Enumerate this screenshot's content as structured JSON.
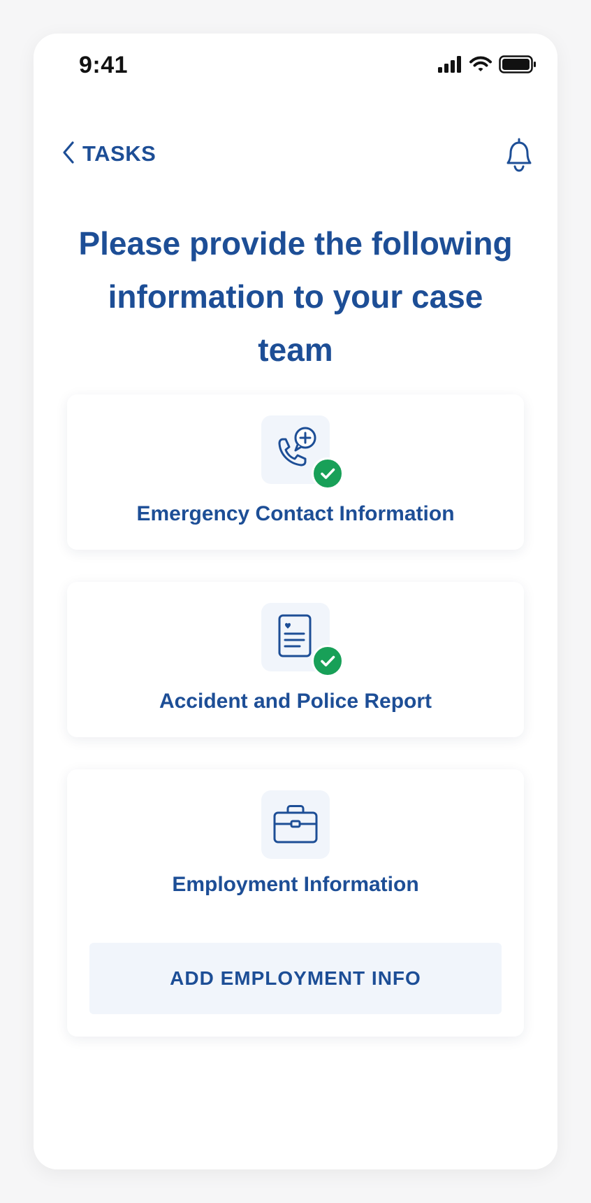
{
  "status_bar": {
    "time": "9:41"
  },
  "nav": {
    "back_label": "TASKS"
  },
  "headline": "Please provide the following information to your case team",
  "tasks": [
    {
      "title": "Emergency Contact Information",
      "icon": "phone-chat-icon",
      "completed": true
    },
    {
      "title": "Accident and Police Report",
      "icon": "report-document-icon",
      "completed": true
    },
    {
      "title": "Employment Information",
      "icon": "briefcase-icon",
      "completed": false,
      "action_label": "ADD EMPLOYMENT INFO"
    }
  ],
  "colors": {
    "primary": "#1d4e96",
    "success": "#18a058",
    "icon_background": "#f1f5fb"
  }
}
